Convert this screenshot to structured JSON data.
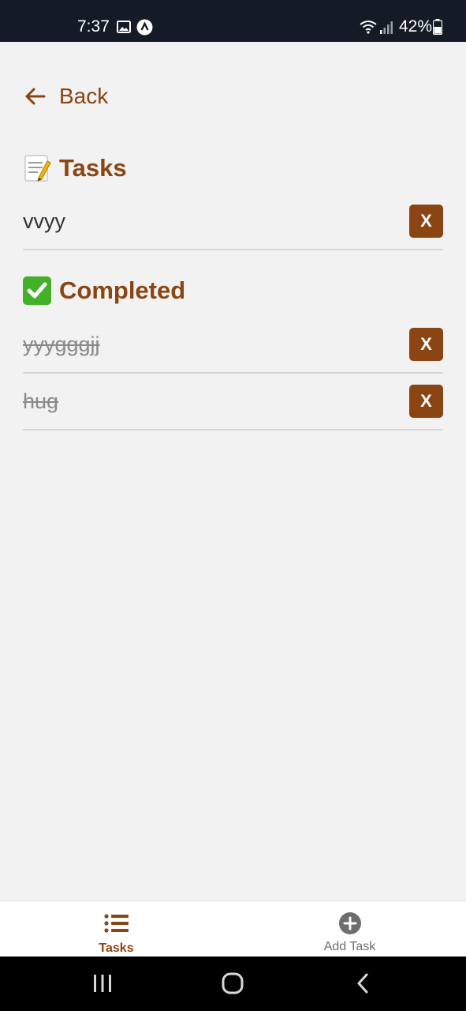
{
  "status_bar": {
    "time": "7:37",
    "battery": "42%",
    "icons": [
      "gallery-icon",
      "app-notification-icon",
      "wifi-icon",
      "signal-icon",
      "battery-icon"
    ]
  },
  "header": {
    "back_label": "Back",
    "back_icon": "arrow-left-icon"
  },
  "tasks_section": {
    "emoji": "📝",
    "title": "Tasks",
    "items": [
      {
        "text": "vvyy",
        "delete_label": "X"
      }
    ]
  },
  "completed_section": {
    "emoji": "✅",
    "title": "Completed",
    "items": [
      {
        "text": "yyyggg​jj",
        "delete_label": "X"
      },
      {
        "text": "hug",
        "delete_label": "X"
      }
    ]
  },
  "tab_bar": {
    "tabs": [
      {
        "label": "Tasks",
        "icon": "list-icon",
        "active": true
      },
      {
        "label": "Add Task",
        "icon": "plus-circle-icon",
        "active": false
      }
    ]
  },
  "nav_bar": {
    "buttons": [
      "recents-icon",
      "home-icon",
      "back-nav-icon"
    ]
  },
  "colors": {
    "accent": "#8b4513",
    "background": "#f2f2f2",
    "status_bar": "#141b26",
    "inactive_tab": "#6e6e6e"
  }
}
